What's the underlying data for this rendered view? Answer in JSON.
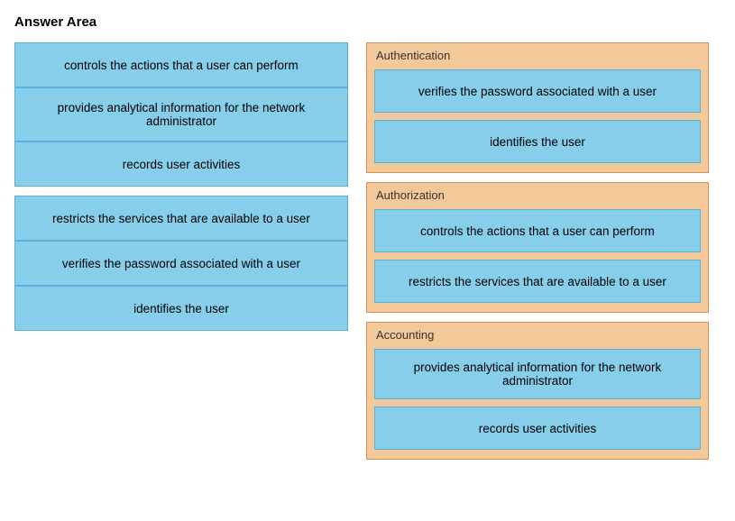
{
  "page": {
    "title": "Answer Area"
  },
  "left_column": {
    "items": [
      {
        "id": "left-controls",
        "text": "controls the actions that a user can perform"
      },
      {
        "id": "left-provides",
        "text": "provides analytical information for the network administrator"
      },
      {
        "id": "left-records",
        "text": "records user activities"
      },
      {
        "id": "left-restricts",
        "text": "restricts the services that are available to a user"
      },
      {
        "id": "left-verifies",
        "text": "verifies the password associated with a user"
      },
      {
        "id": "left-identifies",
        "text": "identifies the user"
      }
    ]
  },
  "right_column": {
    "categories": [
      {
        "id": "authentication",
        "title": "Authentication",
        "items": [
          {
            "id": "auth-verifies",
            "text": "verifies the password associated with a user"
          },
          {
            "id": "auth-identifies",
            "text": "identifies the user"
          }
        ]
      },
      {
        "id": "authorization",
        "title": "Authorization",
        "items": [
          {
            "id": "authz-controls",
            "text": "controls the actions that a user can perform"
          },
          {
            "id": "authz-restricts",
            "text": "restricts the services that are available to a user"
          }
        ]
      },
      {
        "id": "accounting",
        "title": "Accounting",
        "items": [
          {
            "id": "acc-provides",
            "text": "provides analytical information for the network administrator"
          },
          {
            "id": "acc-records",
            "text": "records user activities"
          }
        ]
      }
    ]
  }
}
